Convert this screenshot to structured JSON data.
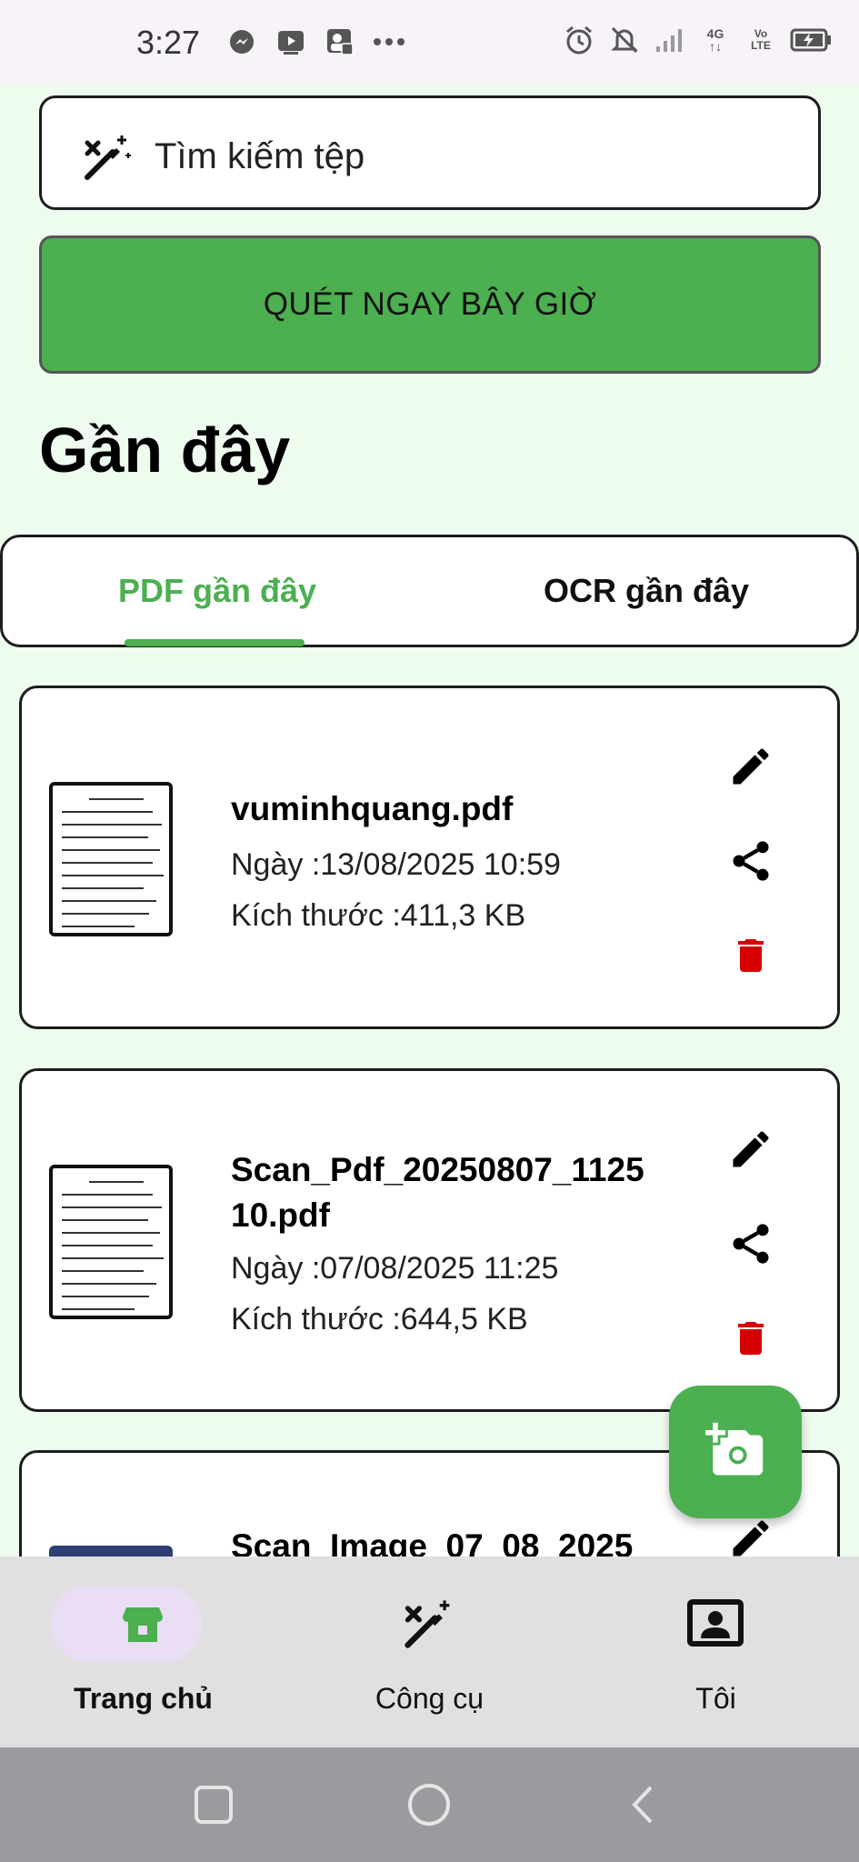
{
  "status_bar": {
    "time": "3:27",
    "network_label": "4G",
    "volte_label": "Vo LTE"
  },
  "search": {
    "placeholder": "Tìm kiếm tệp"
  },
  "scan_button": {
    "label": "QUÉT NGAY BÂY GIỜ"
  },
  "section": {
    "title": "Gần đây"
  },
  "tabs": [
    {
      "label": "PDF gần đây",
      "active": true
    },
    {
      "label": "OCR gần đây",
      "active": false
    }
  ],
  "files": [
    {
      "name": "vuminhquang.pdf",
      "date": "Ngày :13/08/2025 10:59",
      "size": "Kích thước :411,3 KB"
    },
    {
      "name": "Scan_Pdf_20250807_112510.pdf",
      "name_line1": "Scan_Pdf_20250807_1125",
      "name_line2": "10.pdf",
      "date": "Ngày :07/08/2025 11:25",
      "size": "Kích thước :644,5 KB"
    },
    {
      "name": "Scan_Image_07_08_2025"
    }
  ],
  "bottom_nav": [
    {
      "label": "Trang chủ",
      "icon": "home-icon",
      "active": true
    },
    {
      "label": "Công cụ",
      "icon": "tools-icon",
      "active": false
    },
    {
      "label": "Tôi",
      "icon": "profile-icon",
      "active": false
    }
  ],
  "colors": {
    "accent": "#4caf50",
    "delete": "#d50000",
    "background": "#eefcef"
  }
}
